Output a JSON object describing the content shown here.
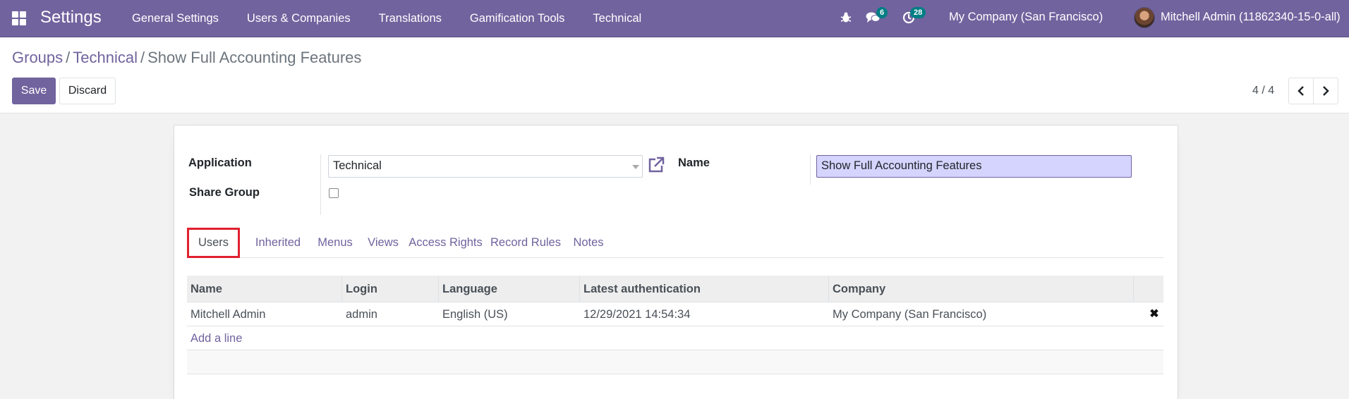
{
  "navbar": {
    "app_title": "Settings",
    "menu": [
      "General Settings",
      "Users & Companies",
      "Translations",
      "Gamification Tools",
      "Technical"
    ],
    "messages_count": "6",
    "activities_count": "28",
    "company": "My Company (San Francisco)",
    "user": "Mitchell Admin (11862340-15-0-all)",
    "colors": {
      "primary": "#71639e",
      "badge": "#017e84"
    }
  },
  "breadcrumb": {
    "groups": "Groups",
    "sep1": "/",
    "technical": "Technical",
    "sep2": "/",
    "current": "Show Full Accounting Features"
  },
  "actions": {
    "save": "Save",
    "discard": "Discard"
  },
  "pager": {
    "value": "4 / 4"
  },
  "form": {
    "application_label": "Application",
    "application_value": "Technical",
    "share_group_label": "Share Group",
    "share_group_checked": false,
    "name_label": "Name",
    "name_value": "Show Full Accounting Features"
  },
  "tabs": [
    "Users",
    "Inherited",
    "Menus",
    "Views",
    "Access Rights",
    "Record Rules",
    "Notes"
  ],
  "active_tab": "Users",
  "table": {
    "headers": [
      "Name",
      "Login",
      "Language",
      "Latest authentication",
      "Company"
    ],
    "rows": [
      [
        "Mitchell Admin",
        "admin",
        "English (US)",
        "12/29/2021 14:54:34",
        "My Company (San Francisco)"
      ]
    ],
    "add_line": "Add a line"
  }
}
